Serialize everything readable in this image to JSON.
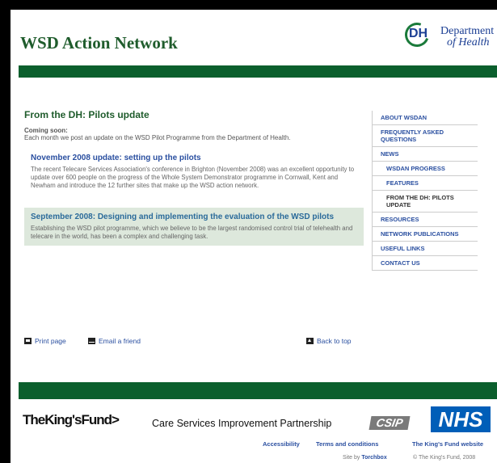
{
  "header": {
    "site_title": "WSD Action Network",
    "dh_letters": "DH",
    "dh_line1": "Department",
    "dh_line2": "of Health"
  },
  "main": {
    "title": "From the DH: Pilots update",
    "coming_label": "Coming soon:",
    "coming_text": "Each month we post an update on the WSD Pilot Programme from the Department of Health.",
    "updates": [
      {
        "title": "November 2008 update: setting up the pilots",
        "text": "The recent Telecare Services Association's conference in Brighton (November 2008) was an excellent opportunity to update over 600 people on the progress of the Whole System Demonstrator programme in Cornwall, Kent and Newham and introduce the 12 further sites that make up the WSD action network."
      },
      {
        "title": "September 2008: Designing and implementing the evaluation of the WSD pilots",
        "text": "Establishing the WSD pilot programme, which we believe to be the largest randomised control trial of telehealth and telecare in the world, has been a complex and challenging task."
      }
    ]
  },
  "rnav": {
    "items": [
      "ABOUT WSDAN",
      "FREQUENTLY ASKED QUESTIONS",
      "NEWS",
      "WSDAN PROGRESS",
      "FEATURES",
      "FROM THE DH: PILOTS UPDATE",
      "RESOURCES",
      "NETWORK PUBLICATIONS",
      "USEFUL LINKS",
      "CONTACT US"
    ]
  },
  "utility": {
    "print": "Print page",
    "email": "Email a friend",
    "back_to_top": "Back to top"
  },
  "footer": {
    "kings_fund_logo": "TheKing'sFund>",
    "csip_text": "Care Services Improvement Partnership",
    "csip_badge": "CSIP",
    "nhs_badge": "NHS",
    "accessibility": "Accessibility",
    "terms": "Terms and conditions",
    "kings_site": "The King's Fund website",
    "site_by_label": "Site by",
    "site_by": "Torchbox",
    "copyright": "© The King's Fund, 2008"
  },
  "colors": {
    "brand_green": "#0b5f2d",
    "link_blue": "#2a4fa0",
    "highlight_bg": "#dde8dc",
    "nhs_blue": "#005eb8"
  }
}
